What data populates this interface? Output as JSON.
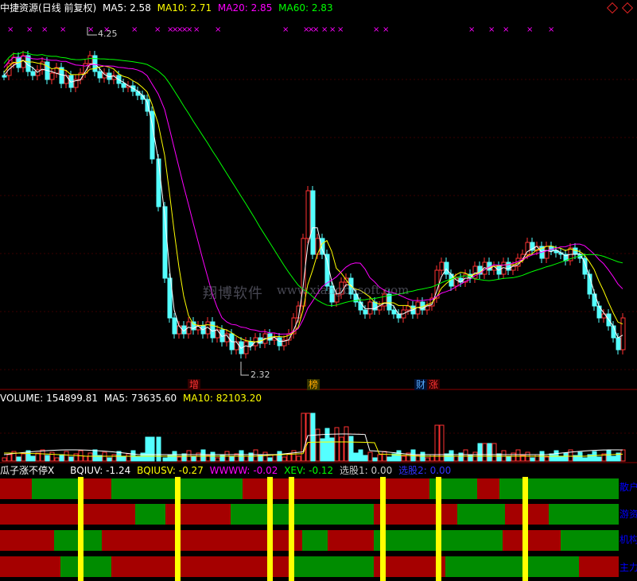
{
  "stock": {
    "name": "中捷资源",
    "period": "(日线 前复权)",
    "ma5_label": "MA5:",
    "ma5": "2.58",
    "ma10_label": "MA10:",
    "ma10": "2.71",
    "ma20_label": "MA20:",
    "ma20": "2.85",
    "ma60_label": "MA60:",
    "ma60": "2.83"
  },
  "price_annotations": {
    "high": "4.25",
    "low": "2.32"
  },
  "event_tags": [
    {
      "text": "增",
      "color": "#ff3333"
    },
    {
      "text": "榜",
      "color": "#ffaa00"
    },
    {
      "text": "财",
      "color": "#55aaff"
    },
    {
      "text": "涨",
      "color": "#ff3333"
    }
  ],
  "watermark": {
    "cn": "翔博软件",
    "url": "www.xiangbosoft.com"
  },
  "volume": {
    "label": "VOLUME:",
    "value": "154899.81",
    "ma5_label": "MA5:",
    "ma5": "73635.60",
    "ma10_label": "MA10:",
    "ma10": "82103.20"
  },
  "indicator": {
    "name": "瓜子涨不停X",
    "bqiuv_label": "BQIUV:",
    "bqiuv": "-1.24",
    "bqiusv_label": "BQIUSV:",
    "bqiusv": "-0.27",
    "wwww_label": "WWWW:",
    "wwww": "-0.02",
    "xev_label": "XEV:",
    "xev": "-0.12",
    "xg1_label": "选股1:",
    "xg1": "0.00",
    "xg2_label": "选股2:",
    "xg2": "0.00"
  },
  "band_labels": [
    "散户",
    "游资",
    "机构",
    "主力"
  ],
  "colors": {
    "up": "#ff3232",
    "down": "#54ffff",
    "ma5": "#ffffff",
    "ma10": "#ffff00",
    "ma20": "#ff00ff",
    "ma60": "#00ff00",
    "band_red": "#a50000",
    "band_green": "#008c00",
    "band_marker": "#ffff00"
  }
}
